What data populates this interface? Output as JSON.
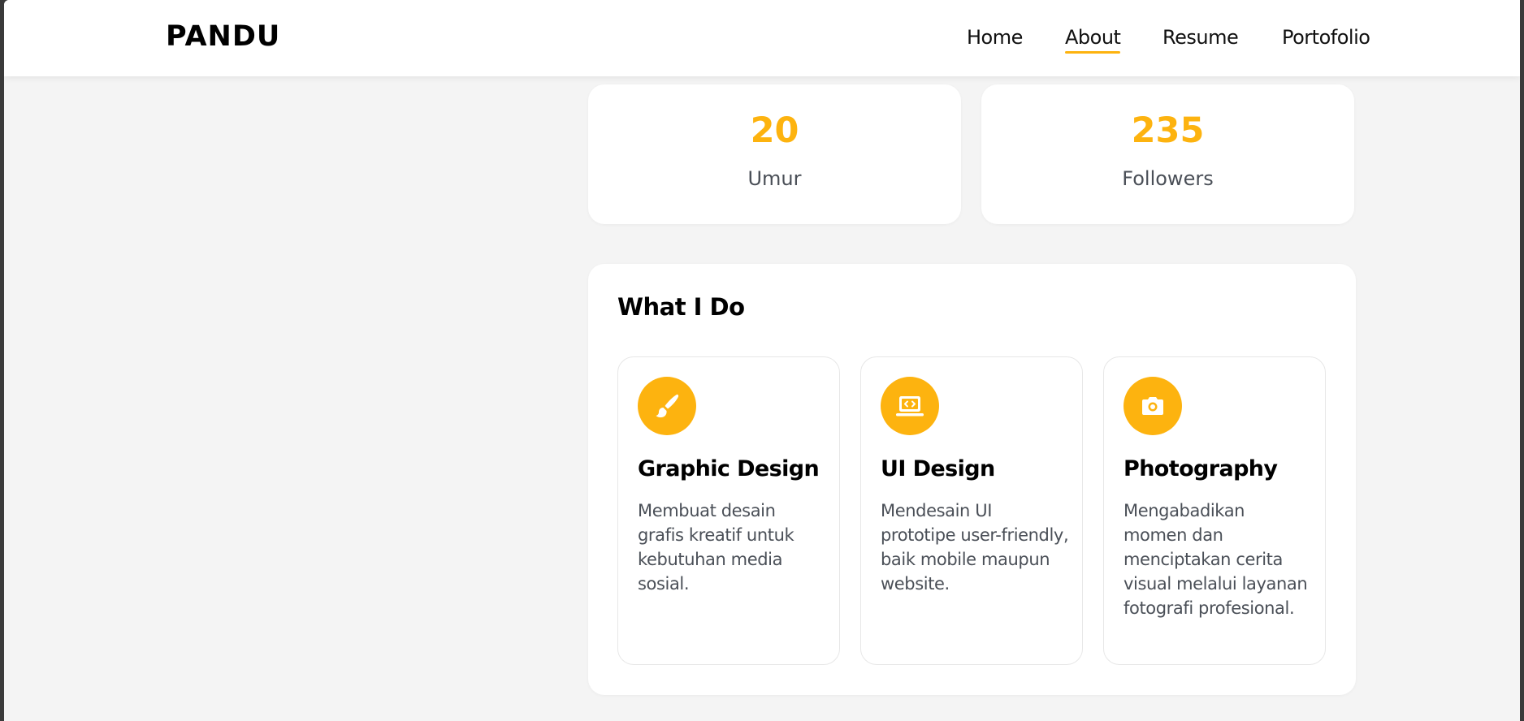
{
  "header": {
    "brand": "PANDU",
    "nav": [
      {
        "label": "Home",
        "active": false
      },
      {
        "label": "About",
        "active": true
      },
      {
        "label": "Resume",
        "active": false
      },
      {
        "label": "Portofolio",
        "active": false
      }
    ]
  },
  "stats": [
    {
      "value": "20",
      "label": "Umur"
    },
    {
      "value": "235",
      "label": "Followers"
    }
  ],
  "what_i_do": {
    "title": "What I Do",
    "services": [
      {
        "icon": "paintbrush-icon",
        "title": "Graphic Design",
        "description": "Membuat desain grafis kreatif untuk kebutuhan media sosial."
      },
      {
        "icon": "laptop-code-icon",
        "title": "UI Design",
        "description": "Mendesain UI prototipe user-friendly, baik mobile maupun website."
      },
      {
        "icon": "camera-icon",
        "title": "Photography",
        "description": "Mengabadikan momen dan menciptakan cerita visual melalui layanan fotografi profesional."
      }
    ]
  },
  "colors": {
    "accent": "#fdb30f",
    "page_background": "#f4f4f4",
    "card_background": "#ffffff",
    "body_text": "#4a4f57"
  }
}
